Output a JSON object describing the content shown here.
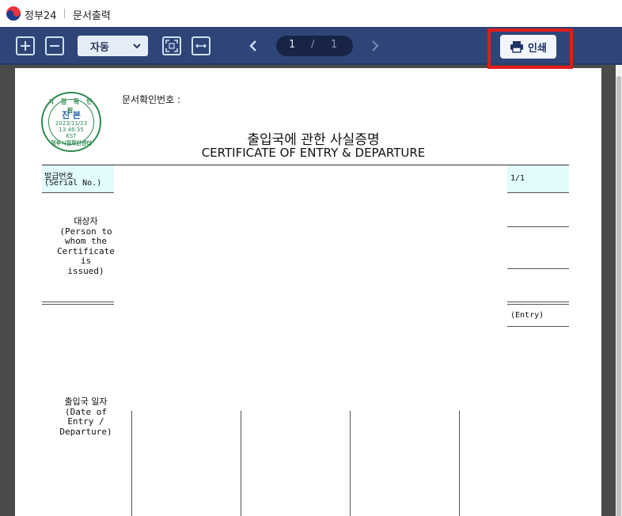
{
  "titlebar": {
    "app_name": "정부24",
    "window_title": "문서출력"
  },
  "toolbar": {
    "zoom_in_icon": "plus-square-icon",
    "zoom_out_icon": "minus-square-icon",
    "zoom_value": "자동",
    "page_current": "1",
    "page_separator": "/",
    "page_total": "1",
    "print_label": "인쇄",
    "highlight_color": "#e31b1b"
  },
  "document": {
    "verification_label": "문서확인번호 :",
    "title_ko": "출입국에 관한 사실증명",
    "title_en": "CERTIFICATE OF ENTRY & DEPARTURE",
    "serial_label_ko": "발급번호",
    "serial_label_en": "(Serial No.)",
    "page_count": "1/1",
    "person_label": [
      "대상자",
      "(Person to",
      "whom the",
      "Certificate",
      "is",
      "issued)"
    ],
    "entry_label": "(Entry)",
    "date_label": [
      "출입국 일자",
      "(Date of",
      "Entry /",
      "Departure)"
    ],
    "stamp": {
      "top": "시 점 확 인 필",
      "center": "진 본",
      "date": "2023/11/23",
      "time": "13:46:35",
      "zone": "KST",
      "bottom": "정부시점확인센터"
    }
  },
  "colors": {
    "toolbar": "#2f4578",
    "page_pill": "#172446",
    "cell_highlight": "#e2fbfd",
    "stamp_green": "#2d8a4e"
  }
}
